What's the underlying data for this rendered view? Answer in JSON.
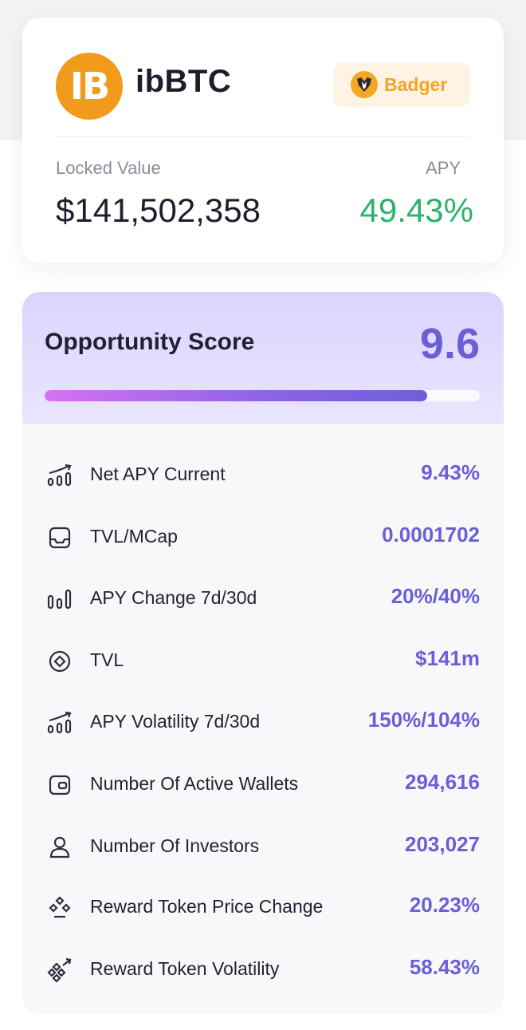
{
  "token": {
    "logo_icon": "bitcoin-ib-icon",
    "logo_glyph": "IB",
    "name": "ibBTC"
  },
  "protocol": {
    "icon": "badger-icon",
    "name": "Badger"
  },
  "stats": {
    "locked_value_label": "Locked Value",
    "locked_value": "$141,502,358",
    "apy_label": "APY",
    "apy": "49.43%"
  },
  "score": {
    "title": "Opportunity Score",
    "value": "9.6",
    "progress_fraction": 0.88
  },
  "metrics": [
    {
      "icon": "trending-bars-icon",
      "label": "Net APY Current",
      "value": "9.43%"
    },
    {
      "icon": "inbox-icon",
      "label": "TVL/MCap",
      "value": "0.0001702"
    },
    {
      "icon": "bar-columns-icon",
      "label": "APY Change 7d/30d",
      "value": "20%/40%"
    },
    {
      "icon": "target-diamond-icon",
      "label": "TVL",
      "value": "$141m"
    },
    {
      "icon": "trending-bars-icon",
      "label": "APY Volatility 7d/30d",
      "value": "150%/104%"
    },
    {
      "icon": "wallet-icon",
      "label": "Number Of Active Wallets",
      "value": "294,616"
    },
    {
      "icon": "user-icon",
      "label": "Number Of Investors",
      "value": "203,027"
    },
    {
      "icon": "token-diamonds-icon",
      "label": "Reward Token Price Change",
      "value": "20.23%"
    },
    {
      "icon": "token-diamonds-trend-icon",
      "label": "Reward Token Volatility",
      "value": "58.43%"
    }
  ],
  "colors": {
    "accent": "#6b5fd6",
    "positive": "#2bb36b",
    "badge": "#f5a524",
    "token": "#f29a1c"
  }
}
